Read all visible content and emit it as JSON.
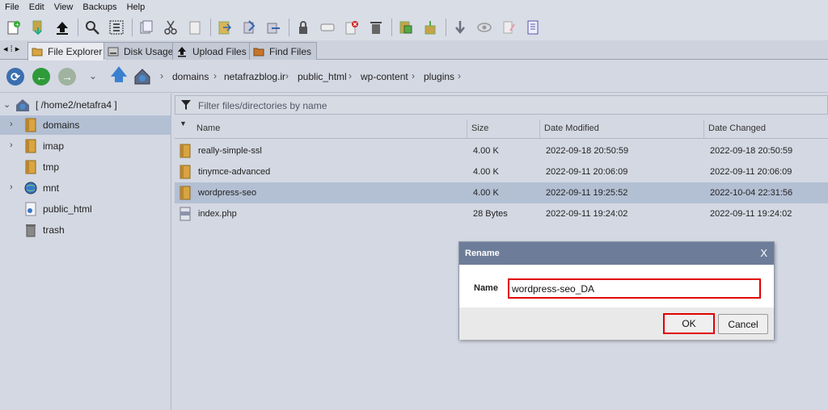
{
  "menu": [
    "File",
    "Edit",
    "View",
    "Backups",
    "Help"
  ],
  "toolbar_icons": [
    "new-file-icon",
    "download-icon",
    "upload-icon",
    "search-icon",
    "select-all-icon",
    "copy-icon",
    "cut-icon",
    "paste-icon",
    "folder-icon",
    "move-icon",
    "copy-to-icon",
    "permissions-icon",
    "rename-icon",
    "delete-disabled-icon",
    "trash-icon",
    "compress-icon",
    "extract-icon",
    "download-arrow-icon",
    "view-icon",
    "edit-icon",
    "properties-icon"
  ],
  "tabs": [
    {
      "label": "File Explorer",
      "icon": "folder-icon"
    },
    {
      "label": "Disk Usage",
      "icon": "disk-icon"
    },
    {
      "label": "Upload Files",
      "icon": "upload-icon"
    },
    {
      "label": "Find Files",
      "icon": "find-icon"
    }
  ],
  "breadcrumb": [
    "domains",
    "netafrazblog.ir",
    "public_html",
    "wp-content",
    "plugins"
  ],
  "tree": {
    "root": "[ /home2/netafra4 ]",
    "items": [
      {
        "label": "domains",
        "icon": "folder-icon",
        "expandable": true
      },
      {
        "label": "imap",
        "icon": "folder-icon",
        "expandable": true
      },
      {
        "label": "tmp",
        "icon": "folder-icon",
        "expandable": false
      },
      {
        "label": "mnt",
        "icon": "globe-icon",
        "expandable": true
      },
      {
        "label": "public_html",
        "icon": "web-file-icon",
        "expandable": false
      },
      {
        "label": "trash",
        "icon": "trash-icon",
        "expandable": false
      }
    ]
  },
  "filter_placeholder": "Filter files/directories by name",
  "columns": [
    "Name",
    "Size",
    "Date Modified",
    "Date Changed"
  ],
  "files": [
    {
      "name": "really-simple-ssl",
      "size": "4.00 K",
      "modified": "2022-09-18 20:50:59",
      "changed": "2022-09-18 20:50:59",
      "type": "folder"
    },
    {
      "name": "tinymce-advanced",
      "size": "4.00 K",
      "modified": "2022-09-11 20:06:09",
      "changed": "2022-09-11 20:06:09",
      "type": "folder"
    },
    {
      "name": "wordpress-seo",
      "size": "4.00 K",
      "modified": "2022-09-11 19:25:52",
      "changed": "2022-10-04 22:31:56",
      "type": "folder"
    },
    {
      "name": "index.php",
      "size": "28 Bytes",
      "modified": "2022-09-11 19:24:02",
      "changed": "2022-09-11 19:24:02",
      "type": "file"
    }
  ],
  "dialog": {
    "title": "Rename",
    "close": "X",
    "field_label": "Name",
    "field_value": "wordpress-seo_DA",
    "ok": "OK",
    "cancel": "Cancel"
  },
  "colors": {
    "highlight": "#e00000",
    "selection": "#b3bfd3",
    "dialog_title": "#6d7c98"
  }
}
